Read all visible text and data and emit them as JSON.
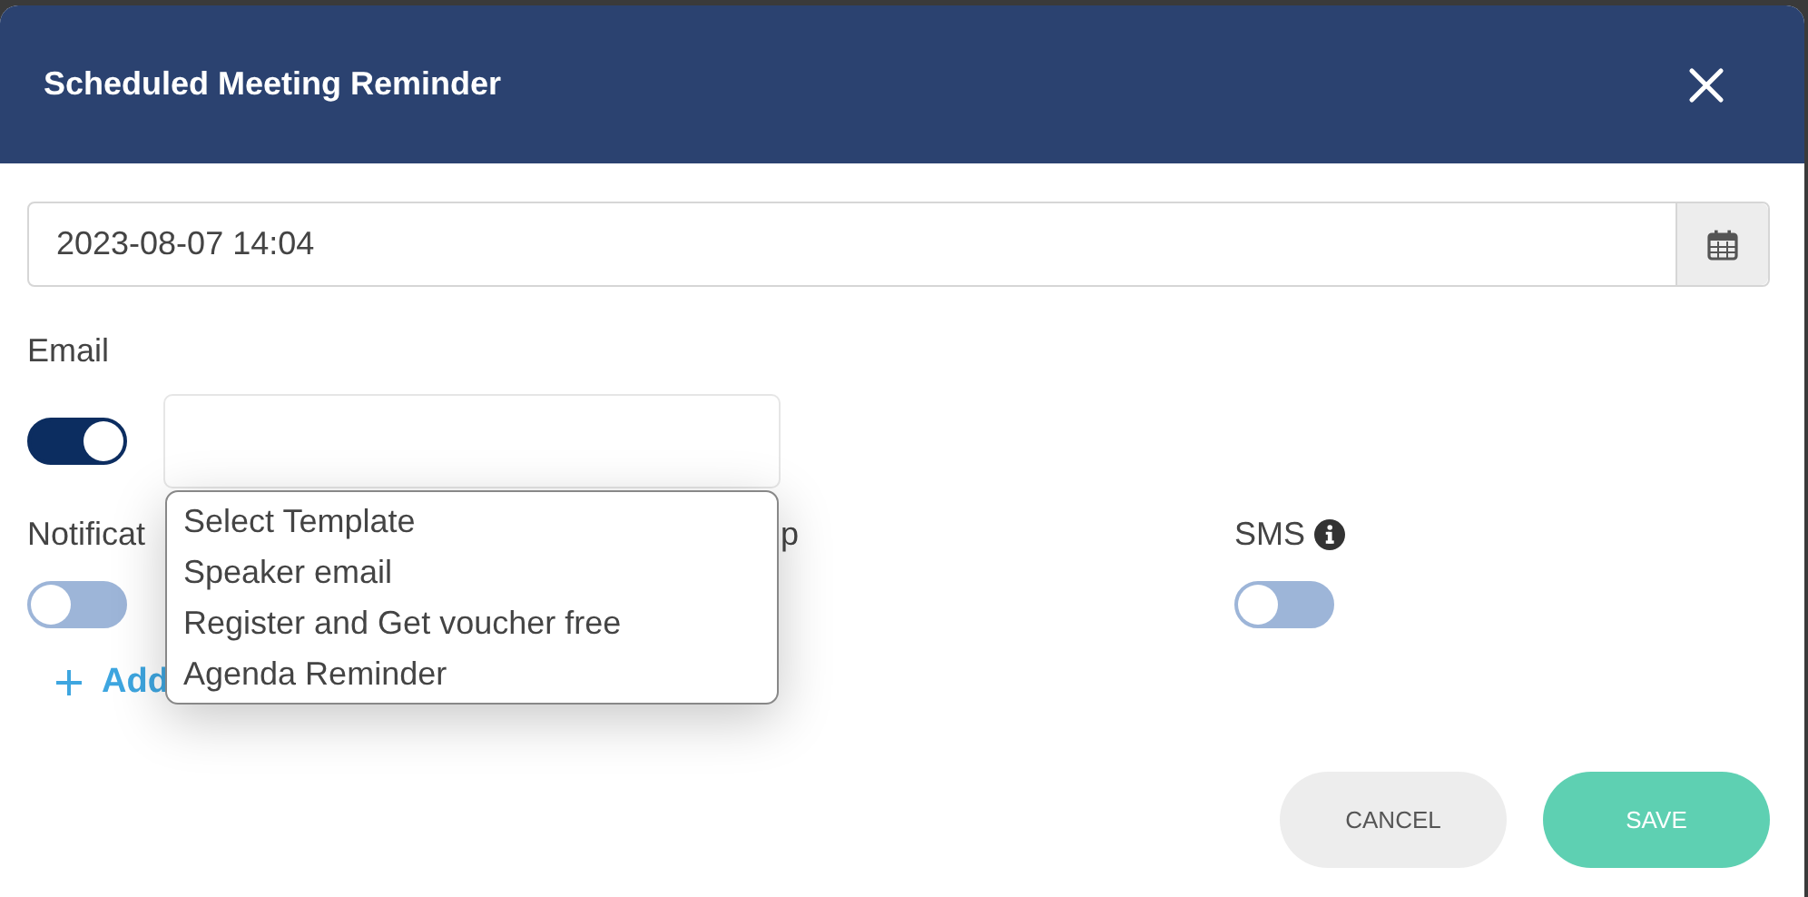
{
  "dialog": {
    "title": "Scheduled Meeting Reminder"
  },
  "datetime": {
    "value": "2023-08-07 14:04"
  },
  "email": {
    "label": "Email",
    "on": true,
    "template_dropdown": {
      "expanded": true,
      "options": [
        {
          "label": "Select Template"
        },
        {
          "label": "Speaker email"
        },
        {
          "label": "Register and Get voucher free"
        },
        {
          "label": "Agenda Reminder"
        }
      ]
    }
  },
  "notifications": [
    {
      "label": "Notificat",
      "info": false,
      "on": false
    },
    {
      "label": "p",
      "info": false
    },
    {
      "label": "SMS",
      "info": true,
      "on": false
    }
  ],
  "add_link": {
    "label": "Add"
  },
  "buttons": [
    {
      "label": "CANCEL",
      "kind": "secondary"
    },
    {
      "label": "SAVE",
      "kind": "primary"
    }
  ]
}
